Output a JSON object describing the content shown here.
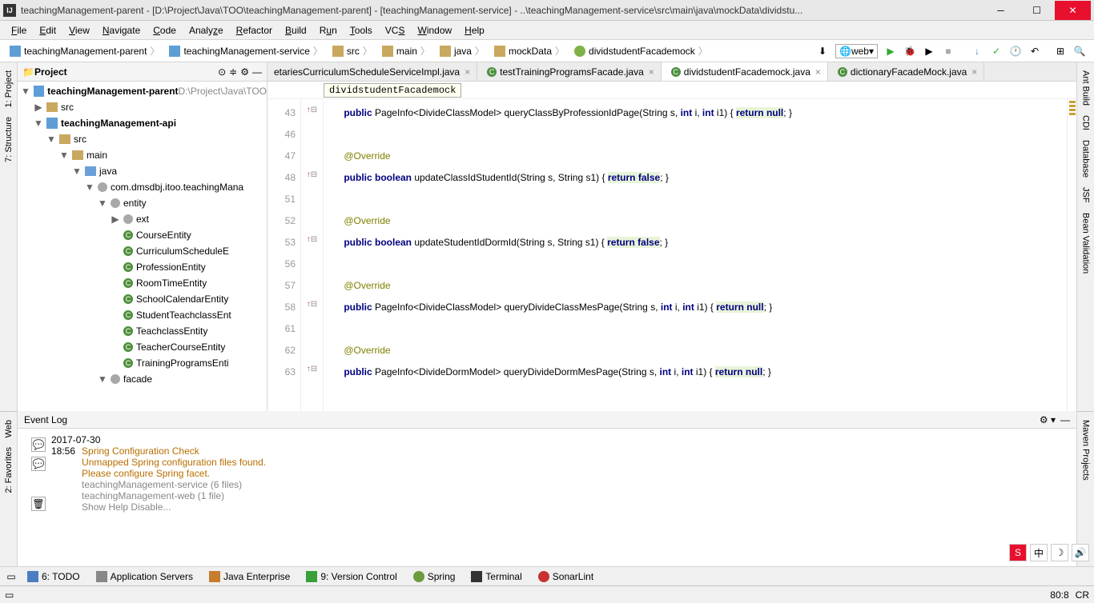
{
  "window": {
    "title": "teachingManagement-parent - [D:\\Project\\Java\\TOO\\teachingManagement-parent] - [teachingManagement-service] - ..\\teachingManagement-service\\src\\main\\java\\mockData\\dividstu..."
  },
  "menu": {
    "file": "File",
    "edit": "Edit",
    "view": "View",
    "navigate": "Navigate",
    "code": "Code",
    "analyze": "Analyze",
    "refactor": "Refactor",
    "build": "Build",
    "run": "Run",
    "tools": "Tools",
    "vcs": "VCS",
    "window": "Window",
    "help": "Help"
  },
  "breadcrumb": {
    "items": [
      "teachingManagement-parent",
      "teachingManagement-service",
      "src",
      "main",
      "java",
      "mockData",
      "dividstudentFacademock"
    ]
  },
  "run_config": "web",
  "project_panel": {
    "title": "Project",
    "root": "teachingManagement-parent",
    "root_path": "D:\\Project\\Java\\TOO"
  },
  "tree": {
    "src1": "src",
    "api": "teachingManagement-api",
    "src2": "src",
    "main": "main",
    "java": "java",
    "pkg": "com.dmsdbj.itoo.teachingMana",
    "entity": "entity",
    "ext": "ext",
    "classes": [
      "CourseEntity",
      "CurriculumScheduleE",
      "ProfessionEntity",
      "RoomTimeEntity",
      "SchoolCalendarEntity",
      "StudentTeachclassEnt",
      "TeachclassEntity",
      "TeacherCourseEntity",
      "TrainingProgramsEnti"
    ],
    "facade": "facade"
  },
  "tabs": {
    "t0": "etariesCurriculumScheduleServiceImpl.java",
    "t1": "testTrainingProgramsFacade.java",
    "t2": "dividstudentFacademock.java",
    "t3": "dictionaryFacadeMock.java"
  },
  "crumb2": "dividstudentFacademock",
  "gutter": [
    "43",
    "46",
    "47",
    "48",
    "51",
    "52",
    "53",
    "56",
    "57",
    "58",
    "61",
    "62",
    "63"
  ],
  "code": {
    "l43": "public PageInfo<DivideClassModel> queryClassByProfessionIdPage(String s, int i, int i1) { return null; }",
    "l47": "@Override",
    "l48": "public boolean updateClassIdStudentId(String s, String s1) { return false; }",
    "l52": "@Override",
    "l53": "public boolean updateStudentIdDormId(String s, String s1) { return false; }",
    "l57": "@Override",
    "l58": "public PageInfo<DivideClassModel> queryDivideClassMesPage(String s, int i, int i1) { return null; }",
    "l62": "@Override",
    "l63": "public PageInfo<DivideDormModel> queryDivideDormMesPage(String s, int i, int i1) { return null; }"
  },
  "left_tools": {
    "project": "1: Project",
    "structure": "7: Structure",
    "web": "Web",
    "fav": "2: Favorites"
  },
  "right_tools": {
    "ant": "Ant Build",
    "cdi": "CDI",
    "db": "Database",
    "jsf": "JSF",
    "bean": "Bean Validation",
    "maven": "Maven Projects"
  },
  "event": {
    "title": "Event Log",
    "date": "2017-07-30",
    "time": "18:56",
    "msg1": "Spring Configuration Check",
    "msg2": "Unmapped Spring configuration files found.",
    "msg3": "Please configure Spring facet.",
    "line1": "teachingManagement-service (6 files)",
    "line2": "teachingManagement-web (1 file)",
    "line3": "Show Help Disable..."
  },
  "bottom": {
    "todo": "6: TODO",
    "app": "Application Servers",
    "java": "Java Enterprise",
    "vc": "9: Version Control",
    "spring": "Spring",
    "term": "Terminal",
    "sonar": "SonarLint"
  },
  "status": {
    "pos": "80:8",
    "enc": "CR"
  }
}
